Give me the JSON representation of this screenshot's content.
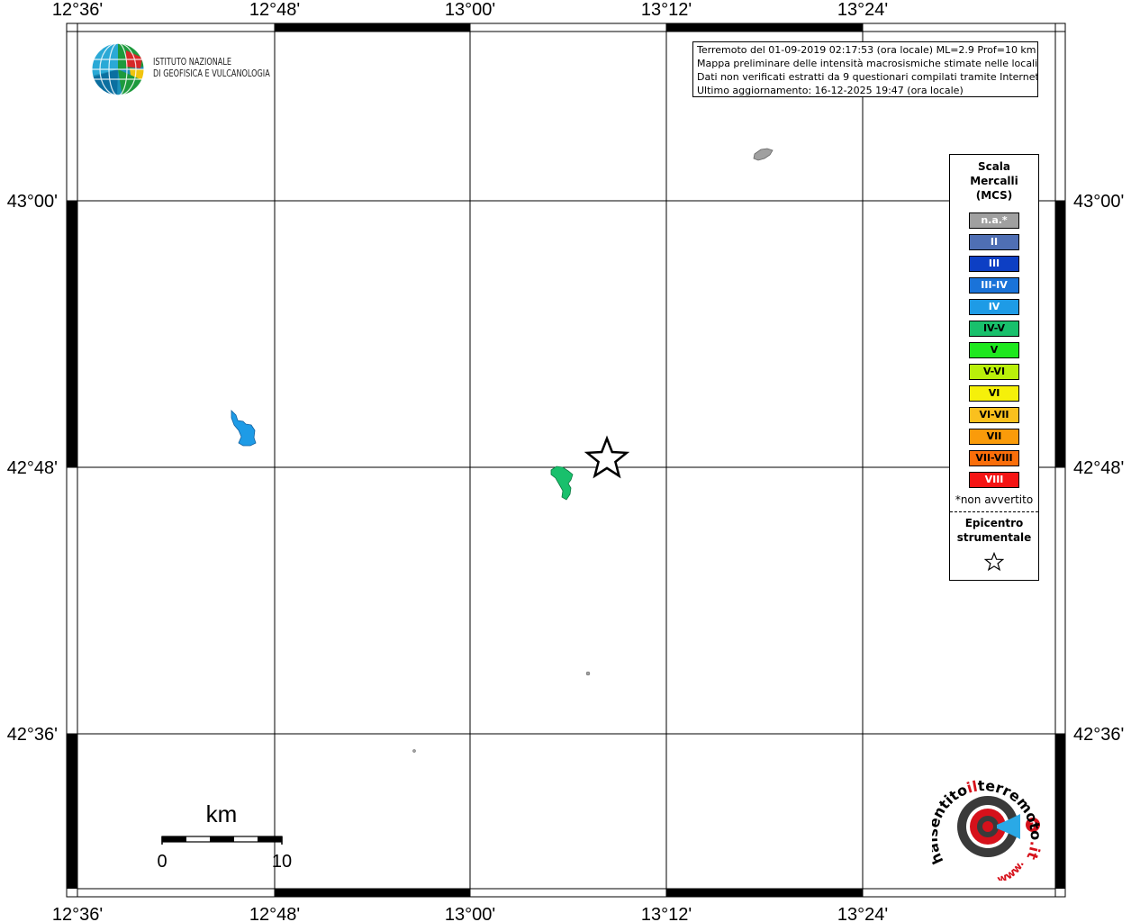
{
  "map": {
    "lon_ticks_top": [
      "12°36'",
      "12°48'",
      "13°00'",
      "13°12'",
      "13°24'"
    ],
    "lon_ticks_bottom": [
      "12°36'",
      "12°48'",
      "13°00'",
      "13°12'",
      "13°24'"
    ],
    "lat_ticks_left": [
      "43°00'",
      "42°48'",
      "42°36'"
    ],
    "lat_ticks_right": [
      "43°00'",
      "42°48'",
      "42°36'"
    ]
  },
  "logo": {
    "line1": "ISTITUTO NAZIONALE",
    "line2": "DI GEOFISICA E VULCANOLOGIA"
  },
  "info": {
    "line1": "Terremoto del 01-09-2019 02:17:53 (ora locale) ML=2.9 Prof=10 km",
    "line2": "Mappa preliminare delle intensità macrosismiche stimate nelle località",
    "line3": "Dati non verificati estratti da 9 questionari compilati tramite Internet.",
    "line4": "Ultimo aggiornamento: 16-12-2025 19:47 (ora locale)"
  },
  "legend": {
    "title1": "Scala",
    "title2": "Mercalli",
    "title3": "(MCS)",
    "items": [
      {
        "label": "n.a.*",
        "color": "#a0a0a0",
        "text_color": "#ffffff"
      },
      {
        "label": "II",
        "color": "#4f6fb4",
        "text_color": "#ffffff"
      },
      {
        "label": "III",
        "color": "#0d3fc4",
        "text_color": "#ffffff"
      },
      {
        "label": "III-IV",
        "color": "#1a73d9",
        "text_color": "#ffffff"
      },
      {
        "label": "IV",
        "color": "#1e9be6",
        "text_color": "#ffffff"
      },
      {
        "label": "IV-V",
        "color": "#19c06c",
        "text_color": "#000000"
      },
      {
        "label": "V",
        "color": "#1ee81e",
        "text_color": "#000000"
      },
      {
        "label": "V-VI",
        "color": "#b9f00a",
        "text_color": "#000000"
      },
      {
        "label": "VI",
        "color": "#f5f00a",
        "text_color": "#000000"
      },
      {
        "label": "VI-VII",
        "color": "#fac01e",
        "text_color": "#000000"
      },
      {
        "label": "VII",
        "color": "#fa9b0a",
        "text_color": "#000000"
      },
      {
        "label": "VII-VIII",
        "color": "#fa6e0a",
        "text_color": "#000000"
      },
      {
        "label": "VIII",
        "color": "#f51414",
        "text_color": "#ffffff"
      }
    ],
    "note": "*non avvertito",
    "epicenter1": "Epicentro",
    "epicenter2": "strumentale"
  },
  "scale_bar": {
    "unit": "km",
    "start": "0",
    "end": "10"
  },
  "hst_logo": {
    "text_hai": "hai",
    "text_sentito": "sentito",
    "text_il": "il",
    "text_terremoto": "terremoto",
    "text_it": ".it",
    "text_www": "www."
  },
  "colors": {
    "intensity_iv": "#1e9be6",
    "intensity_iv_v": "#19c06c",
    "not_felt": "#a0a0a0"
  }
}
